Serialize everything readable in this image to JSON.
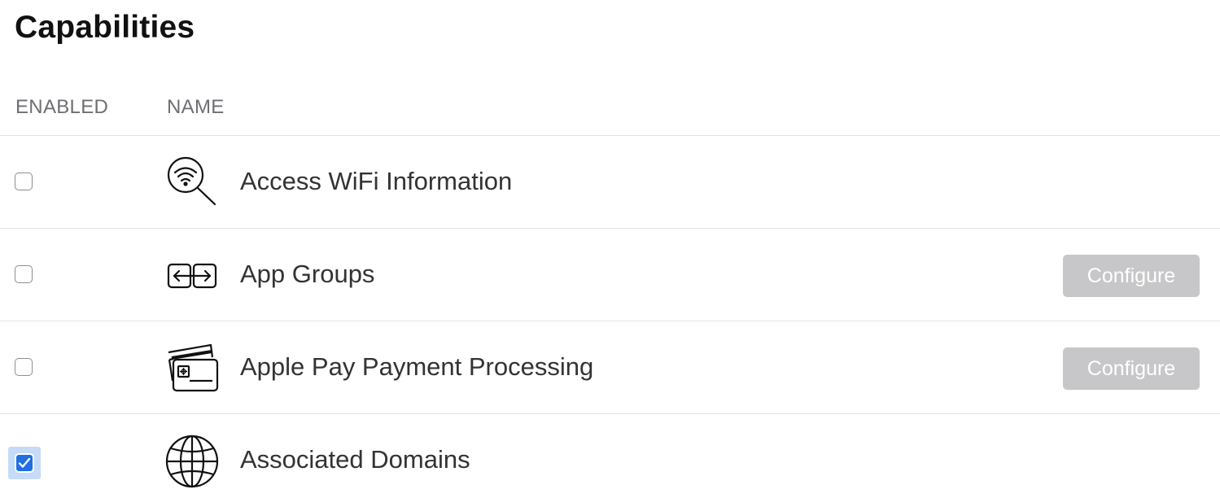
{
  "page": {
    "title": "Capabilities"
  },
  "table": {
    "headers": {
      "enabled": "ENABLED",
      "name": "NAME"
    },
    "rows": [
      {
        "name": "Access WiFi Information",
        "icon": "wifi-search-icon",
        "enabled": false,
        "configure_label": ""
      },
      {
        "name": "App Groups",
        "icon": "app-groups-icon",
        "enabled": false,
        "configure_label": "Configure"
      },
      {
        "name": "Apple Pay Payment Processing",
        "icon": "payment-cards-icon",
        "enabled": false,
        "configure_label": "Configure"
      },
      {
        "name": "Associated Domains",
        "icon": "globe-icon",
        "enabled": true,
        "configure_label": ""
      }
    ]
  },
  "colors": {
    "checkbox_checked": "#1f6fe5",
    "configure_disabled_bg": "#c7c7c9",
    "divider": "#e3e3e6"
  }
}
